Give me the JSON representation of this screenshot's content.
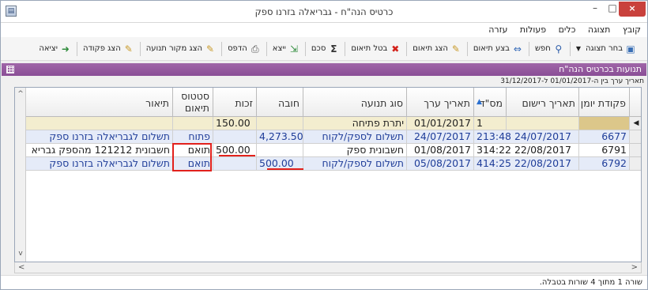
{
  "window": {
    "title": "כרטיס הנה\"ח - גבריאלה בזרנו ספק",
    "minimize": "–",
    "maximize": "□",
    "close": "×"
  },
  "menu": [
    {
      "label": "קובץ"
    },
    {
      "label": "תצוגה"
    },
    {
      "label": "כלים"
    },
    {
      "label": "פעולות"
    },
    {
      "label": "עזרה"
    }
  ],
  "toolbar": {
    "select_view": "בחר תצוגה",
    "search": "חפש",
    "do_match": "בצע תיאום",
    "show_match": "הצג תיאום",
    "cancel_match": "בטל תיאום",
    "sum": "סכם",
    "export": "ייצא",
    "print": "הדפס",
    "show_source": "הצג מקור תנועה",
    "show_entry": "הצג פקודה",
    "exit": "יציאה"
  },
  "section": {
    "title": "תנועות בכרטיס הנה\"ח",
    "date_range": "תאריך ערך בין ה-01/01/2017 ל-31/12/2017"
  },
  "grid": {
    "columns": {
      "entry": "פקודת יומן",
      "reg_date": "תאריך רישום",
      "serial": "מס\"ד",
      "value_date": "תאריך ערך",
      "move_type": "סוג תנועה",
      "debit": "חובה",
      "credit": "זכות",
      "status_l1": "סטטוס",
      "status_l2": "תיאום",
      "desc": "תיאור"
    },
    "rows": [
      {
        "entry": "",
        "reg_date": "",
        "serial": "1",
        "value_date": "01/01/2017",
        "move_type": "יתרת פתיחה",
        "debit": "",
        "credit": "150.00",
        "status": "",
        "desc": ""
      },
      {
        "entry": "6677",
        "reg_date": "213:48 24/07/2017",
        "serial": "",
        "value_date": "24/07/2017",
        "move_type": "תשלום לספק/לקוח",
        "debit": "4,273.50",
        "credit": "",
        "status": "פתוח",
        "desc": "תשלום לגבריאלה בזרנו ספק"
      },
      {
        "entry": "6791",
        "reg_date": "314:22 22/08/2017",
        "serial": "",
        "value_date": "01/08/2017",
        "move_type": "חשבונית ספק",
        "debit": "",
        "credit": "500.00",
        "status": "תואם",
        "desc": "חשבונית 121212 מהספק גבריא"
      },
      {
        "entry": "6792",
        "reg_date": "414:25 22/08/2017",
        "serial": "",
        "value_date": "05/08/2017",
        "move_type": "תשלום לספק/לקוח",
        "debit": "500.00",
        "credit": "",
        "status": "תואם",
        "desc": "תשלום לגבריאלה בזרנו ספק"
      }
    ]
  },
  "status_bar": "שורה 1 מתוך 4 שורות בטבלה.",
  "colors": {
    "section_bar": "#8a4e96",
    "highlight_box": "#e2211c",
    "opening_row": "#f3edcf",
    "selected_row": "#e5ebf8"
  },
  "icons": [
    "app-icon",
    "view-icon",
    "search-icon",
    "match-icon",
    "show-match-icon",
    "cancel-match-icon",
    "sum-icon",
    "export-icon",
    "print-icon",
    "source-icon",
    "entry-icon",
    "exit-icon",
    "grid-icon"
  ]
}
